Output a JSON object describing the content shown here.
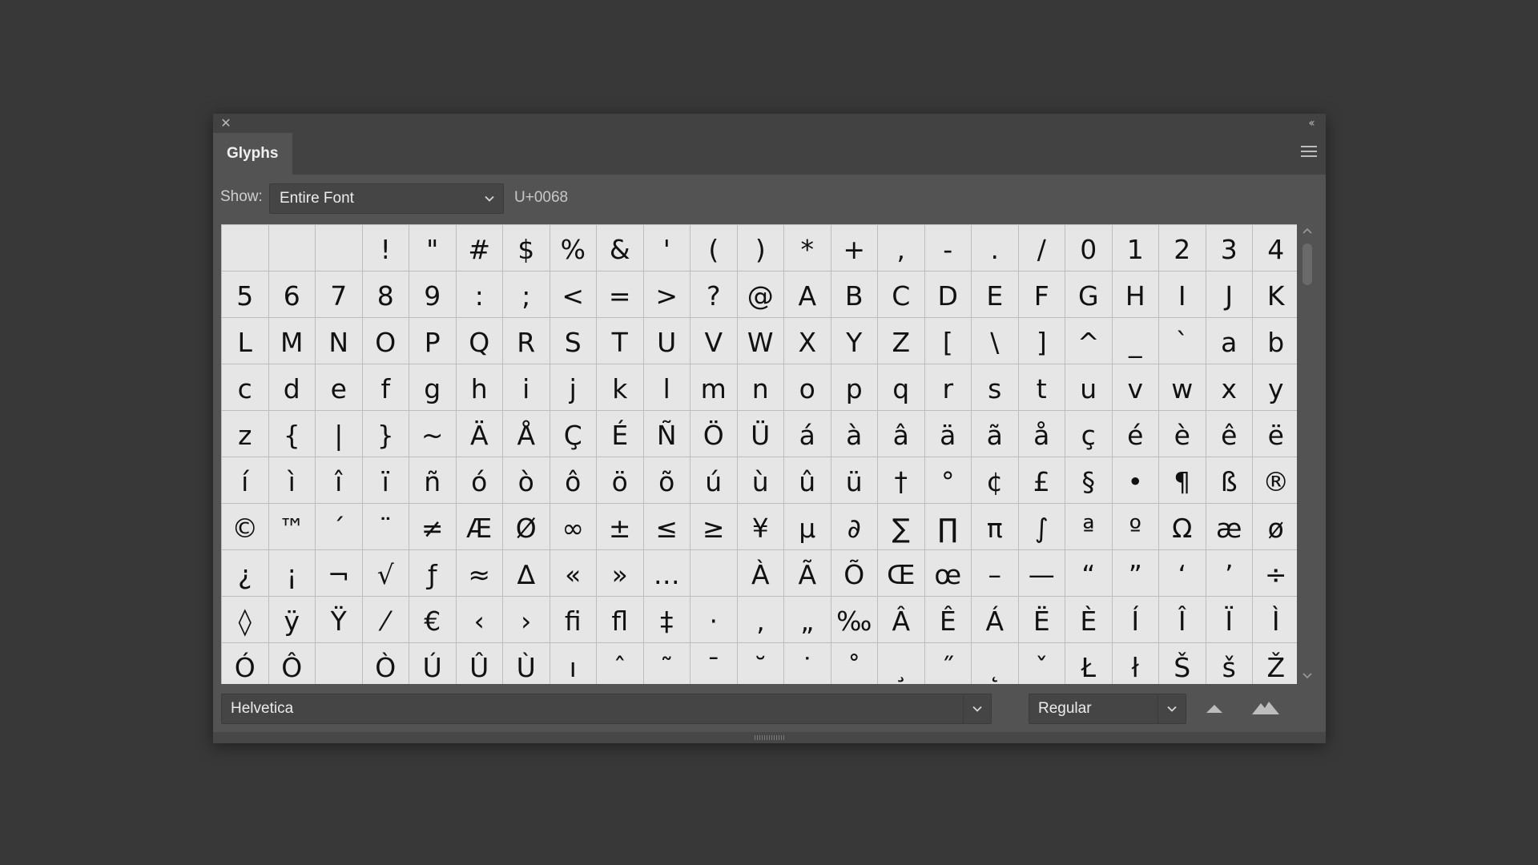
{
  "panel": {
    "tab_label": "Glyphs",
    "show_label": "Show:",
    "show_value": "Entire Font",
    "unicode_value": "U+0068"
  },
  "glyphs": [
    "",
    "",
    "",
    "!",
    "\"",
    "#",
    "$",
    "%",
    "&",
    "'",
    "(",
    ")",
    "*",
    "+",
    ",",
    "-",
    ".",
    "/",
    "0",
    "1",
    "2",
    "3",
    "4",
    "5",
    "6",
    "7",
    "8",
    "9",
    ":",
    ";",
    "<",
    "=",
    ">",
    "?",
    "@",
    "A",
    "B",
    "C",
    "D",
    "E",
    "F",
    "G",
    "H",
    "I",
    "J",
    "K",
    "L",
    "M",
    "N",
    "O",
    "P",
    "Q",
    "R",
    "S",
    "T",
    "U",
    "V",
    "W",
    "X",
    "Y",
    "Z",
    "[",
    "\\",
    "]",
    "^",
    "_",
    "`",
    "a",
    "b",
    "c",
    "d",
    "e",
    "f",
    "g",
    "h",
    "i",
    "j",
    "k",
    "l",
    "m",
    "n",
    "o",
    "p",
    "q",
    "r",
    "s",
    "t",
    "u",
    "v",
    "w",
    "x",
    "y",
    "z",
    "{",
    "|",
    "}",
    "~",
    "Ä",
    "Å",
    "Ç",
    "É",
    "Ñ",
    "Ö",
    "Ü",
    "á",
    "à",
    "â",
    "ä",
    "ã",
    "å",
    "ç",
    "é",
    "è",
    "ê",
    "ë",
    "í",
    "ì",
    "î",
    "ï",
    "ñ",
    "ó",
    "ò",
    "ô",
    "ö",
    "õ",
    "ú",
    "ù",
    "û",
    "ü",
    "†",
    "°",
    "¢",
    "£",
    "§",
    "•",
    "¶",
    "ß",
    "®",
    "©",
    "™",
    "´",
    "¨",
    "≠",
    "Æ",
    "Ø",
    "∞",
    "±",
    "≤",
    "≥",
    "¥",
    "μ",
    "∂",
    "∑",
    "∏",
    "π",
    "∫",
    "ª",
    "º",
    "Ω",
    "æ",
    "ø",
    "¿",
    "¡",
    "¬",
    "√",
    "ƒ",
    "≈",
    "∆",
    "«",
    "»",
    "…",
    "",
    "À",
    "Ã",
    "Õ",
    "Œ",
    "œ",
    "–",
    "—",
    "“",
    "”",
    "‘",
    "’",
    "÷",
    "◊",
    "ÿ",
    "Ÿ",
    "⁄",
    "€",
    "‹",
    "›",
    "ﬁ",
    "ﬂ",
    "‡",
    "·",
    "‚",
    "„",
    "‰",
    "Â",
    "Ê",
    "Á",
    "Ë",
    "È",
    "Í",
    "Î",
    "Ï",
    "Ì",
    "Ó",
    "Ô",
    "",
    "Ò",
    "Ú",
    "Û",
    "Ù",
    "ı",
    "ˆ",
    "˜",
    "¯",
    "˘",
    "˙",
    "˚",
    "¸",
    "˝",
    "˛",
    "ˇ",
    "Ł",
    "ł",
    "Š",
    "š",
    "Ž"
  ],
  "footer": {
    "font_family": "Helvetica",
    "font_style": "Regular"
  },
  "icons": {
    "close": "close-icon",
    "collapse": "collapse-panel-icon",
    "menu": "panel-menu-icon",
    "zoom_out": "mountain-small-icon",
    "zoom_in": "mountain-large-icon"
  }
}
